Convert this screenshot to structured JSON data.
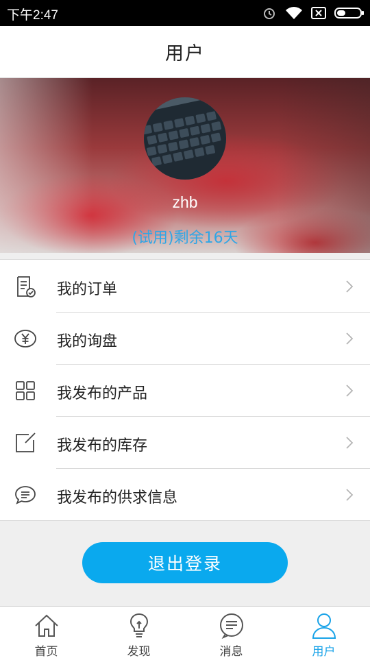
{
  "status_bar": {
    "time": "下午2:47",
    "icons": [
      "alarm-icon",
      "wifi-icon",
      "sim-disabled-icon",
      "battery-icon"
    ]
  },
  "header": {
    "title": "用户"
  },
  "profile": {
    "username": "zhb",
    "trial_text": "(试用)剩余16天",
    "avatar_icon": "keyboard-photo-avatar"
  },
  "menu": {
    "items": [
      {
        "label": "我的订单",
        "icon": "order-receipt-icon"
      },
      {
        "label": "我的询盘",
        "icon": "yen-circle-icon"
      },
      {
        "label": "我发布的产品",
        "icon": "grid-icon"
      },
      {
        "label": "我发布的库存",
        "icon": "edit-box-icon"
      },
      {
        "label": "我发布的供求信息",
        "icon": "chat-bubble-icon"
      }
    ]
  },
  "logout": {
    "label": "退出登录"
  },
  "tabbar": {
    "tabs": [
      {
        "label": "首页",
        "icon": "home-icon"
      },
      {
        "label": "发现",
        "icon": "lightbulb-icon"
      },
      {
        "label": "消息",
        "icon": "message-icon"
      },
      {
        "label": "用户",
        "icon": "user-icon",
        "active": true
      }
    ]
  },
  "colors": {
    "accent": "#0aa9ee",
    "trial_text": "#2ea6e6",
    "active_tab": "#19a3e8"
  }
}
